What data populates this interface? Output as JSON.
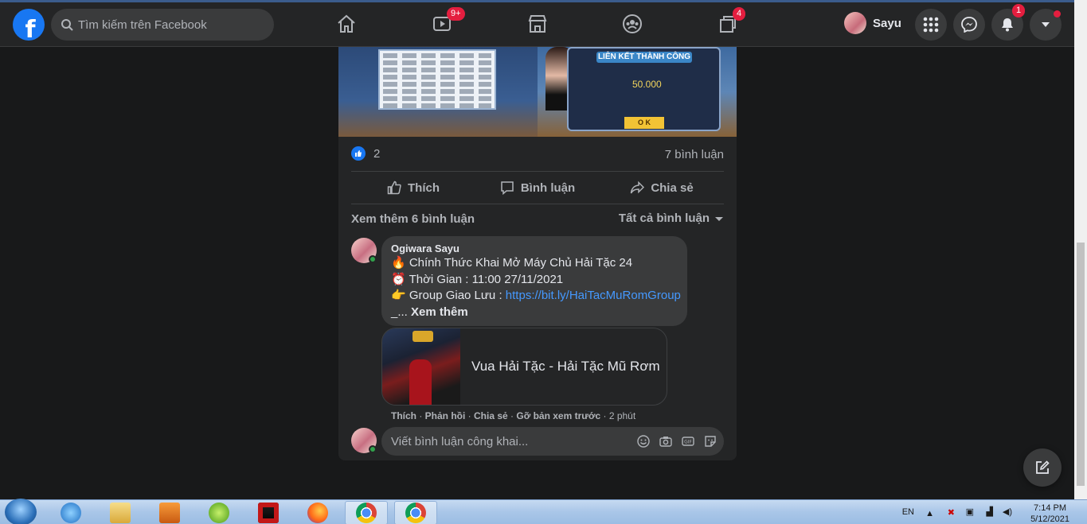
{
  "nav": {
    "logo": "f",
    "search_placeholder": "Tìm kiếm trên Facebook",
    "watch_badge": "9+",
    "groups_badge": "4",
    "profile_name": "Sayu",
    "notif_badge": "1"
  },
  "post": {
    "image_dialog_title": "LIÊN KẾT THÀNH CÔNG",
    "image_dialog_amount": "50.000",
    "image_dialog_ok": "O K",
    "like_count": "2",
    "comment_count": "7 bình luận",
    "actions": {
      "like": "Thích",
      "comment": "Bình luận",
      "share": "Chia sẻ"
    },
    "more_comments": "Xem thêm 6 bình luận",
    "sort_label": "Tất cả bình luận"
  },
  "comment": {
    "author": "Ogiwara Sayu",
    "line1": "🔥 Chính Thức Khai Mở Máy Chủ Hải Tặc 24",
    "line2": "⏰ Thời Gian : 11:00 27/11/2021",
    "line3_prefix": "👉 Group Giao Lưu : ",
    "line3_link": "https://bit.ly/HaiTacMuRomGroup",
    "line4_prefix": "_... ",
    "see_more": "Xem thêm",
    "preview_title": "Vua Hải Tặc - Hải Tặc Mũ Rơm",
    "meta_like": "Thích",
    "meta_reply": "Phản hồi",
    "meta_share": "Chia sẻ",
    "meta_remove_preview": "Gỡ bản xem trước",
    "meta_time": "2 phút"
  },
  "reply": {
    "placeholder": "Viết bình luận công khai..."
  },
  "taskbar": {
    "lang": "EN",
    "time": "7:14 PM",
    "date": "5/12/2021"
  },
  "colors": {
    "background": "#18191a",
    "card": "#242526",
    "accent": "#1877f2",
    "link": "#4599ff",
    "badge": "#e41e3f"
  }
}
